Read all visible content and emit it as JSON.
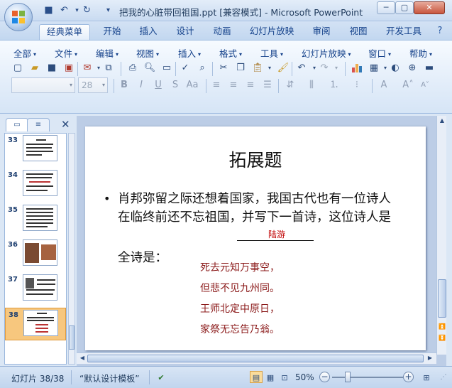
{
  "window": {
    "title": "把我的心脏带回祖国.ppt [兼容模式] - Microsoft PowerPoint",
    "controls": {
      "minimize": "─",
      "maximize": "▢",
      "close": "✕"
    }
  },
  "quick_access": [
    {
      "name": "save-icon",
      "glyph": "💾"
    },
    {
      "name": "undo-icon",
      "glyph": "↶"
    },
    {
      "name": "redo-icon",
      "glyph": "↻"
    },
    {
      "name": "customize-icon",
      "glyph": "▾"
    }
  ],
  "tabs": [
    "经典菜单",
    "开始",
    "插入",
    "设计",
    "动画",
    "幻灯片放映",
    "审阅",
    "视图",
    "开发工具"
  ],
  "active_tab": "经典菜单",
  "menus": [
    "全部",
    "文件",
    "编辑",
    "视图",
    "插入",
    "格式",
    "工具",
    "幻灯片放映",
    "窗口",
    "帮助"
  ],
  "toolbar": {
    "font_name": "",
    "font_size": "28"
  },
  "format_buttons": [
    "B",
    "I",
    "U",
    "S",
    "Aa"
  ],
  "side_panel": {
    "tab_outline_icon": "▭",
    "tab_slides_icon": "≡",
    "close": "✕",
    "thumbnails": [
      {
        "number": "33"
      },
      {
        "number": "34"
      },
      {
        "number": "35"
      },
      {
        "number": "36"
      },
      {
        "number": "37"
      },
      {
        "number": "38"
      }
    ],
    "selected": "38"
  },
  "slide": {
    "title": "拓展题",
    "bullet": "•",
    "body": "肖邦弥留之际还想着国家，我国古代也有一位诗人在临终前还不忘祖国，并写下一首诗，这位诗人是",
    "answer": "陆游",
    "poem_label": "全诗是：",
    "poem": [
      "死去元知万事空，",
      "但悲不见九州同。",
      "王师北定中原日，",
      "家祭无忘告乃翁。"
    ]
  },
  "status": {
    "slide_counter": "幻灯片 38/38",
    "theme": "“默认设计模板”",
    "zoom": "50%",
    "zoom_level": 0.5
  },
  "colors": {
    "answer": "#c00000",
    "poem": "#8b1a1a",
    "selected_thumb": "#f7c77e"
  }
}
